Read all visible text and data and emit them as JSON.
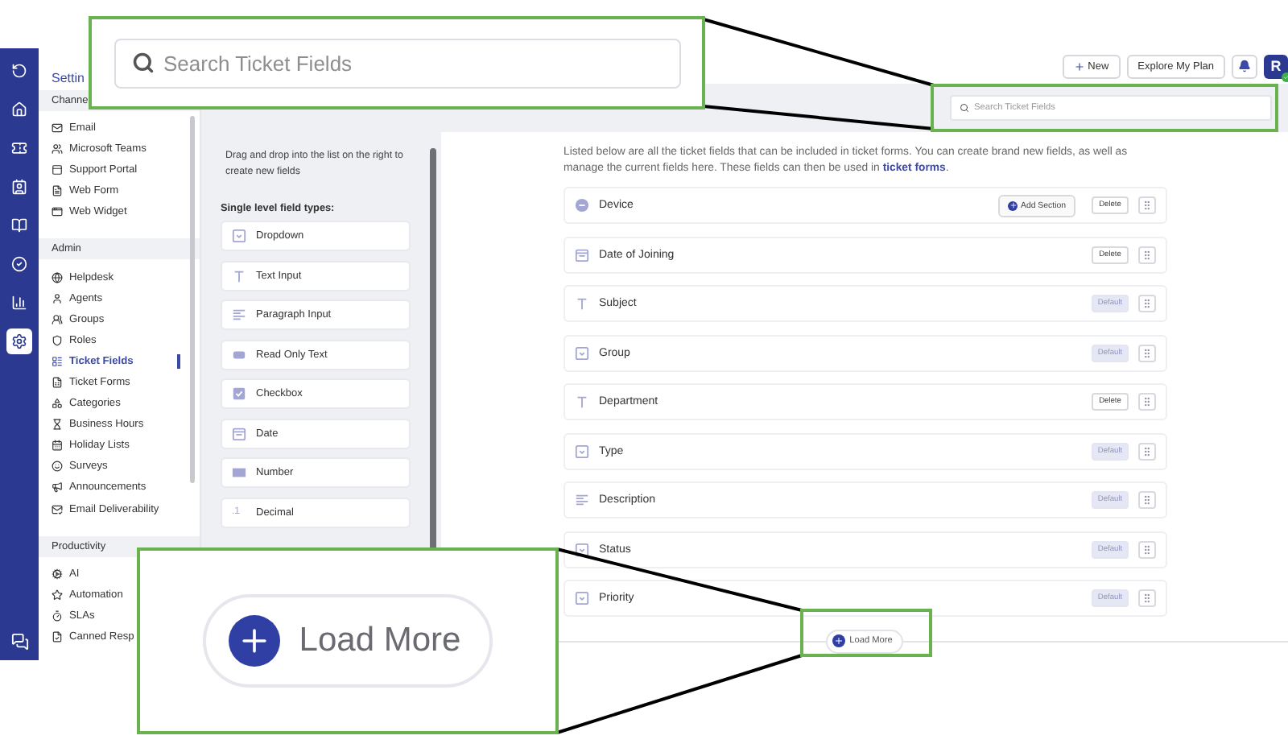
{
  "rail": {
    "items": [
      {
        "selected": false
      },
      {
        "selected": false
      },
      {
        "selected": false
      },
      {
        "selected": false
      },
      {
        "selected": false
      },
      {
        "selected": false
      },
      {
        "selected": false
      },
      {
        "selected": true
      }
    ]
  },
  "header": {
    "title": "Settin",
    "buttons": [
      {
        "label": "New",
        "kind": "new"
      },
      {
        "label": "Explore My Plan",
        "kind": "plain"
      }
    ],
    "avatar": "R"
  },
  "search": {
    "placeholder": "Search Ticket Fields"
  },
  "sidebar": {
    "sections": [
      {
        "title": "Channe",
        "items": [
          {
            "label": "Email",
            "selected": false
          },
          {
            "label": "Microsoft Teams",
            "selected": false
          },
          {
            "label": "Support Portal",
            "selected": false
          },
          {
            "label": "Web Form",
            "selected": false
          },
          {
            "label": "Web Widget",
            "selected": false
          }
        ]
      },
      {
        "title": "Admin",
        "items": [
          {
            "label": "Helpdesk",
            "selected": false
          },
          {
            "label": "Agents",
            "selected": false
          },
          {
            "label": "Groups",
            "selected": false
          },
          {
            "label": "Roles",
            "selected": false
          },
          {
            "label": "Ticket Fields",
            "selected": true
          },
          {
            "label": "Ticket Forms",
            "selected": false
          },
          {
            "label": "Categories",
            "selected": false
          },
          {
            "label": "Business Hours",
            "selected": false
          },
          {
            "label": "Holiday Lists",
            "selected": false
          },
          {
            "label": "Surveys",
            "selected": false
          },
          {
            "label": "Announcements",
            "selected": false
          },
          {
            "label": "Email Deliverability",
            "selected": false
          }
        ]
      },
      {
        "title": "Productivity",
        "items": [
          {
            "label": "AI",
            "selected": false
          },
          {
            "label": "Automation",
            "selected": false
          },
          {
            "label": "SLAs",
            "selected": false
          },
          {
            "label": "Canned Resp",
            "selected": false
          }
        ]
      }
    ]
  },
  "field_types": {
    "intro": "Drag and drop into the list on the right to create new fields",
    "heading": "Single level field types:",
    "items": [
      {
        "label": "Dropdown",
        "kind": "dropdown"
      },
      {
        "label": "Text Input",
        "kind": "text"
      },
      {
        "label": "Paragraph Input",
        "kind": "paragraph"
      },
      {
        "label": "Read Only Text",
        "kind": "readonly"
      },
      {
        "label": "Checkbox",
        "kind": "checkbox"
      },
      {
        "label": "Date",
        "kind": "date"
      },
      {
        "label": "Number",
        "kind": "number"
      },
      {
        "label": "Decimal",
        "kind": "decimal",
        "glyph": ".1"
      }
    ]
  },
  "fields": {
    "description_before": "Listed below are all the ticket fields that can be included in ticket forms. You can create brand new fields, as well as manage the current fields here. These fields can then be used in",
    "link": "ticket forms",
    "description_after": ".",
    "rows": [
      {
        "label": "Device",
        "kind": "section",
        "add_section": "Add Section",
        "badge": "Delete",
        "default": false
      },
      {
        "label": "Date of Joining",
        "kind": "date",
        "badge": "Delete",
        "default": false
      },
      {
        "label": "Subject",
        "kind": "text",
        "badge": "Default",
        "default": true
      },
      {
        "label": "Group",
        "kind": "dropdown",
        "badge": "Default",
        "default": true
      },
      {
        "label": "Department",
        "kind": "text",
        "badge": "Delete",
        "default": false
      },
      {
        "label": "Type",
        "kind": "dropdown",
        "badge": "Default",
        "default": true
      },
      {
        "label": "Description",
        "kind": "paragraph",
        "badge": "Default",
        "default": true
      },
      {
        "label": "Status",
        "kind": "dropdown",
        "badge": "Default",
        "default": true
      },
      {
        "label": "Priority",
        "kind": "dropdown",
        "badge": "Default",
        "default": true
      }
    ],
    "load_more": "Load More"
  },
  "callouts": [
    {
      "kind": "search",
      "placeholder": "Search Ticket Fields"
    },
    {
      "kind": "button",
      "label": "Load More"
    }
  ]
}
